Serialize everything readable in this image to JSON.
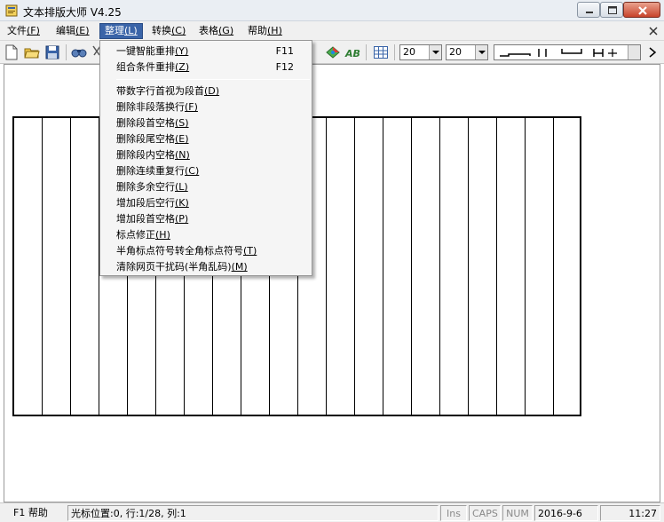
{
  "window": {
    "title": "文本排版大师 V4.25"
  },
  "menubar": {
    "items": [
      {
        "label": "文件",
        "key": "(F)"
      },
      {
        "label": "编辑",
        "key": "(E)"
      },
      {
        "label": "整理",
        "key": "(L)"
      },
      {
        "label": "转换",
        "key": "(C)"
      },
      {
        "label": "表格",
        "key": "(G)"
      },
      {
        "label": "帮助",
        "key": "(H)"
      }
    ]
  },
  "toolbar": {
    "font_size_1": "20",
    "font_size_2": "20"
  },
  "dropdown": {
    "items": [
      {
        "label": "一键智能重排",
        "key": "(Y)",
        "shortcut": "F11"
      },
      {
        "label": "组合条件重排",
        "key": "(Z)",
        "shortcut": "F12"
      },
      {
        "label": "带数字行首视为段首",
        "key": "(D)",
        "shortcut": ""
      },
      {
        "label": "删除非段落换行",
        "key": "(F)",
        "shortcut": ""
      },
      {
        "label": "删除段首空格",
        "key": "(S)",
        "shortcut": ""
      },
      {
        "label": "删除段尾空格",
        "key": "(E)",
        "shortcut": ""
      },
      {
        "label": "删除段内空格",
        "key": "(N)",
        "shortcut": ""
      },
      {
        "label": "删除连续重复行",
        "key": "(C)",
        "shortcut": ""
      },
      {
        "label": "删除多余空行",
        "key": "(L)",
        "shortcut": ""
      },
      {
        "label": "增加段后空行",
        "key": "(K)",
        "shortcut": ""
      },
      {
        "label": "增加段首空格",
        "key": "(P)",
        "shortcut": ""
      },
      {
        "label": "标点修正",
        "key": "(H)",
        "shortcut": ""
      },
      {
        "label": "半角标点符号转全角标点符号",
        "key": "(T)",
        "shortcut": ""
      },
      {
        "label": "清除网页干扰码(半角乱码)",
        "key": "(M)",
        "shortcut": ""
      }
    ]
  },
  "statusbar": {
    "help": "F1 帮助",
    "cursor": "光标位置:0, 行:1/28, 列:1",
    "ins": "Ins",
    "caps": "CAPS",
    "num": "NUM",
    "date": "2016-9-6",
    "time": "11:27"
  }
}
